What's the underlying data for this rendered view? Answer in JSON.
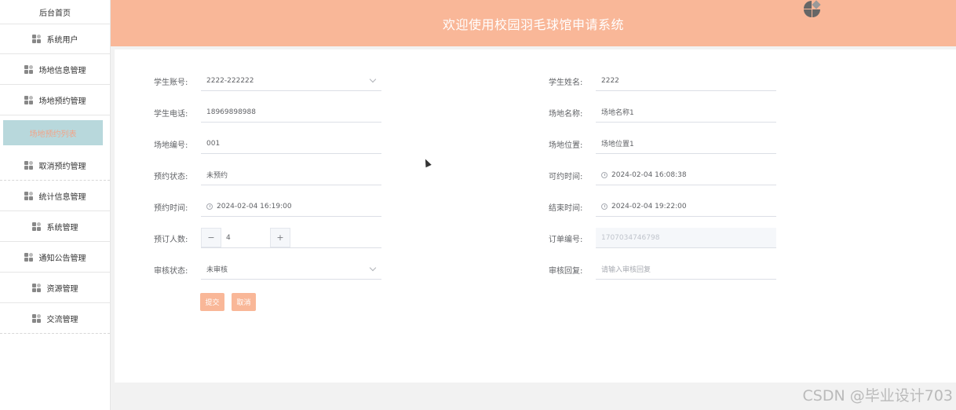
{
  "sidebar": {
    "home": "后台首页",
    "items": [
      {
        "label": "系统用户"
      },
      {
        "label": "场地信息管理"
      },
      {
        "label": "场地预约管理"
      },
      {
        "label": "场地预约列表"
      },
      {
        "label": "取消预约管理"
      },
      {
        "label": "统计信息管理"
      },
      {
        "label": "系统管理"
      },
      {
        "label": "通知公告管理"
      },
      {
        "label": "资源管理"
      },
      {
        "label": "交流管理"
      }
    ]
  },
  "header": {
    "title": "欢迎使用校园羽毛球馆申请系统"
  },
  "form": {
    "student_account": {
      "label": "学生账号:",
      "value": "2222-222222"
    },
    "student_name": {
      "label": "学生姓名:",
      "value": "2222"
    },
    "student_phone": {
      "label": "学生电话:",
      "value": "18969898988"
    },
    "venue_name": {
      "label": "场地名称:",
      "value": "场地名称1"
    },
    "venue_code": {
      "label": "场地编号:",
      "value": "001"
    },
    "venue_location": {
      "label": "场地位置:",
      "value": "场地位置1"
    },
    "booking_status": {
      "label": "预约状态:",
      "value": "未预约"
    },
    "available_time": {
      "label": "可约时间:",
      "value": "2024-02-04 16:08:38"
    },
    "booking_time": {
      "label": "预约时间:",
      "value": "2024-02-04 16:19:00"
    },
    "end_time": {
      "label": "结束时间:",
      "value": "2024-02-04 19:22:00"
    },
    "people_count": {
      "label": "预订人数:",
      "value": "4",
      "minus": "−",
      "plus": "+"
    },
    "order_number": {
      "label": "订单编号:",
      "value": "1707034746798"
    },
    "review_status": {
      "label": "审核状态:",
      "value": "未审核"
    },
    "review_reply": {
      "label": "审核回复:",
      "placeholder": "请输入审核回复"
    },
    "submit": "提交",
    "cancel": "取消"
  },
  "watermark": "CSDN @毕业设计703"
}
